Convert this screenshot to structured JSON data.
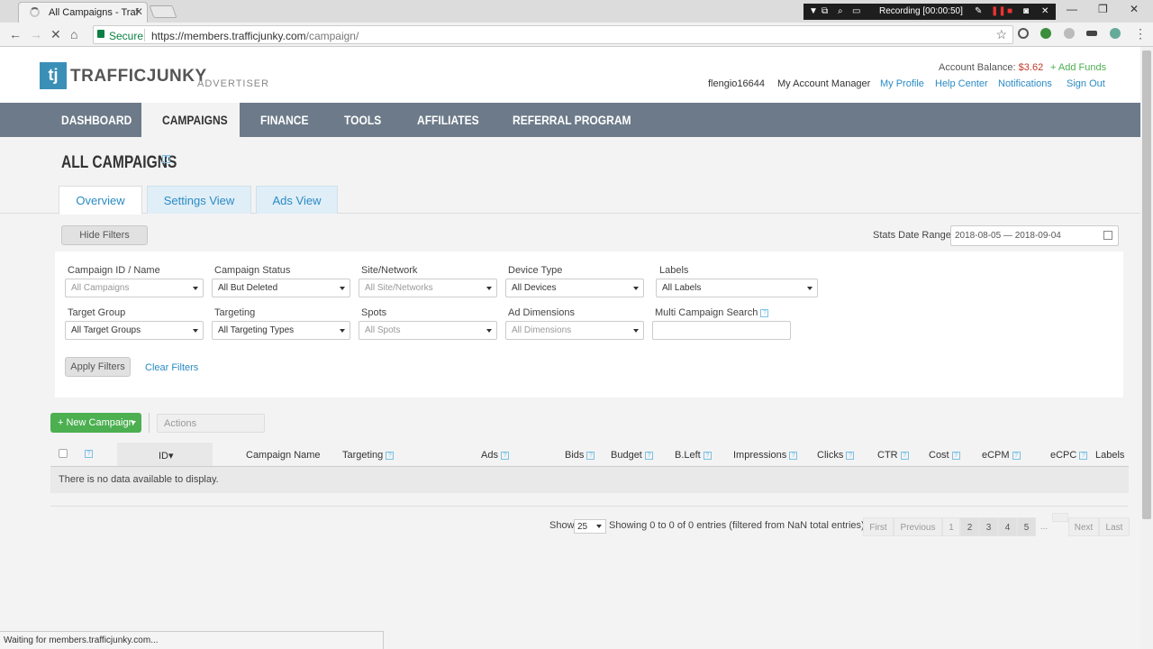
{
  "browser": {
    "tab_title": "All Campaigns - TrafficJunky",
    "tab_close": "✕",
    "recording_label": "Recording [00:00:50]",
    "secure_label": "Secure",
    "url_scheme_host": "https://members.trafficjunky.com",
    "url_path": "/campaign/",
    "status_text": "Waiting for members.trafficjunky.com..."
  },
  "header": {
    "logo_mark": "tj",
    "logo_text": "TRAFFICJUNKY",
    "logo_sub": "ADVERTISER",
    "balance_label": "Account Balance: ",
    "balance_value": "$3.62",
    "add_funds": "+ Add Funds",
    "username": "flengio16644",
    "account_manager": "My Account Manager",
    "links": [
      "My Profile",
      "Help Center",
      "Notifications",
      "Sign Out"
    ]
  },
  "nav": {
    "items": [
      "DASHBOARD",
      "CAMPAIGNS",
      "FINANCE",
      "TOOLS",
      "AFFILIATES",
      "REFERRAL PROGRAM"
    ],
    "active": "CAMPAIGNS"
  },
  "page": {
    "title": "ALL CAMPAIGNS",
    "help": "?",
    "tabs": [
      "Overview",
      "Settings View",
      "Ads View"
    ],
    "active_tab": "Overview"
  },
  "filters": {
    "hide_button": "Hide Filters",
    "date_label": "Stats Date Range",
    "date_value": "2018-08-05 — 2018-09-04",
    "row1": [
      {
        "label": "Campaign ID / Name",
        "value": "All Campaigns"
      },
      {
        "label": "Campaign Status",
        "value": "All But Deleted"
      },
      {
        "label": "Site/Network",
        "value": "All Site/Networks"
      },
      {
        "label": "Device Type",
        "value": "All Devices"
      },
      {
        "label": "Labels",
        "value": "All Labels"
      }
    ],
    "row2": [
      {
        "label": "Target Group",
        "value": "All Target Groups"
      },
      {
        "label": "Targeting",
        "value": "All Targeting Types"
      },
      {
        "label": "Spots",
        "value": "All Spots"
      },
      {
        "label": "Ad Dimensions",
        "value": "All Dimensions"
      },
      {
        "label": "Multi Campaign Search",
        "value": ""
      }
    ],
    "apply_button": "Apply Filters",
    "clear_link": "Clear Filters"
  },
  "toolbar": {
    "new_campaign": "+ New Campaign",
    "actions_placeholder": "Actions"
  },
  "table": {
    "columns": [
      "ID",
      "Campaign Name",
      "Targeting",
      "Ads",
      "Bids",
      "Budget",
      "B.Left",
      "Impressions",
      "Clicks",
      "CTR",
      "Cost",
      "eCPM",
      "eCPC",
      "Labels"
    ],
    "sort_arrow": "▾",
    "empty_message": "There is no data available to display."
  },
  "pagination": {
    "show_label": "Show",
    "page_size": "25",
    "info": "Showing 0 to 0 of 0 entries (filtered from NaN total entries)",
    "first": "First",
    "previous": "Previous",
    "pages": [
      "1",
      "2",
      "3",
      "4",
      "5"
    ],
    "ellipsis": "...",
    "next": "Next",
    "last": "Last"
  },
  "colors": {
    "nav_bg": "#6c7a89",
    "link": "#2a8bc4",
    "green": "#4caf50",
    "balance": "#c0392b"
  }
}
